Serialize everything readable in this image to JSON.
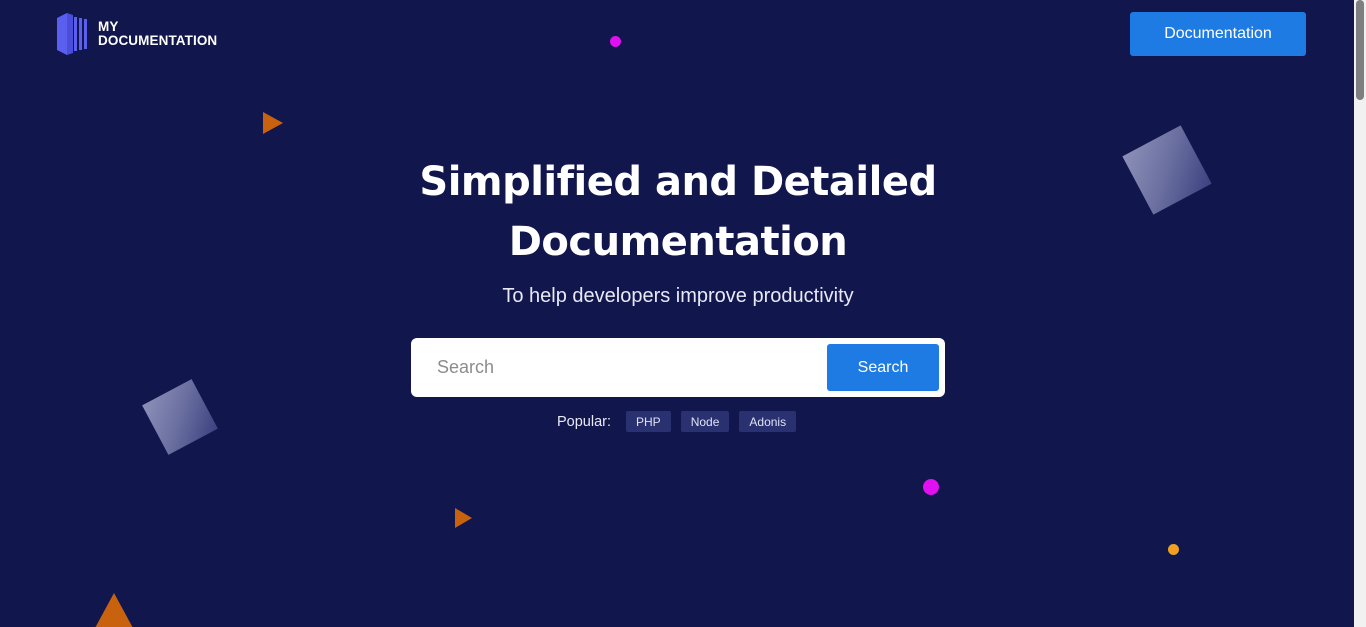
{
  "header": {
    "logo_line1": "MY",
    "logo_line2": "DOCUMENTATION",
    "documentation_button": "Documentation"
  },
  "hero": {
    "title_line1": "Simplified and Detailed",
    "title_line2": "Documentation",
    "subtitle": "To help developers improve productivity"
  },
  "search": {
    "placeholder": "Search",
    "value": "",
    "button_label": "Search"
  },
  "popular": {
    "label": "Popular:",
    "tags": [
      "PHP",
      "Node",
      "Adonis"
    ]
  },
  "colors": {
    "background": "#11164d",
    "accent": "#1e7be4",
    "logo": "#5b5ff0",
    "dot_magenta": "#e010f0",
    "dot_amber": "#f0a020",
    "triangle_orange": "#c8620f"
  },
  "icons": {
    "logo": "book-stack-icon"
  }
}
